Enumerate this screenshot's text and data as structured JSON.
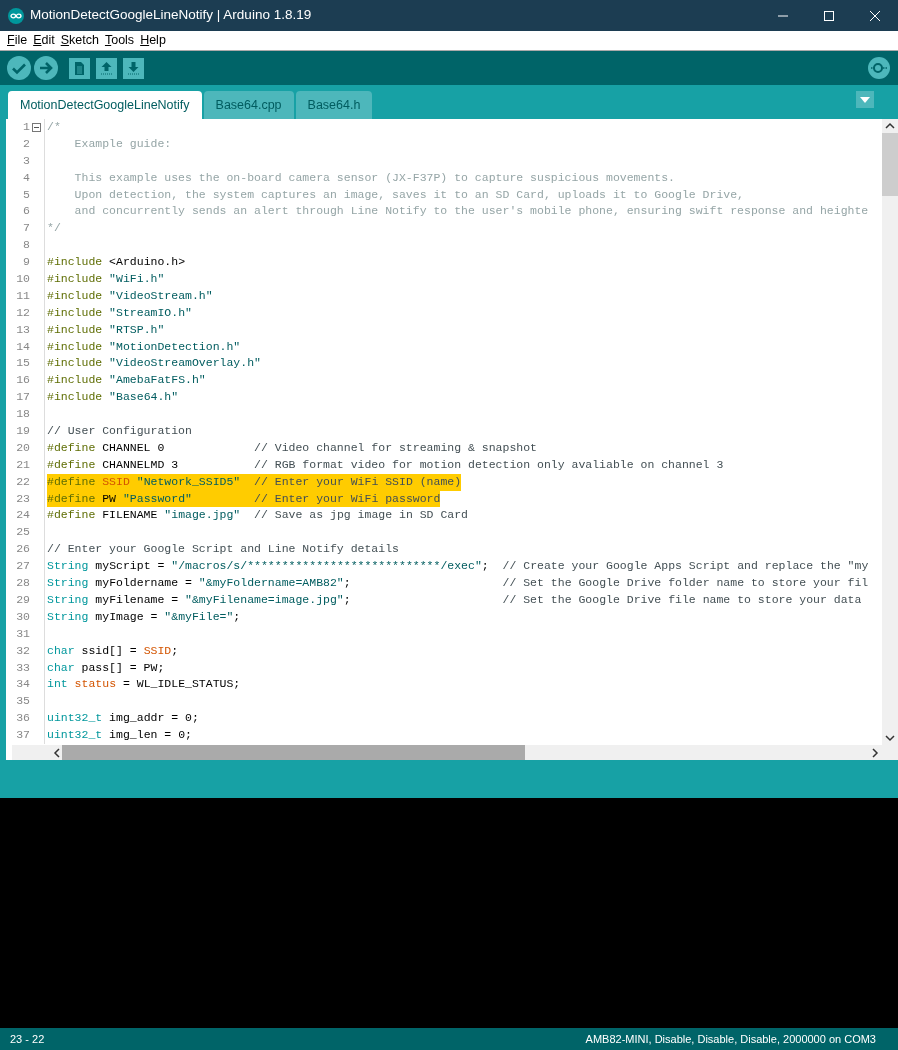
{
  "window": {
    "title": "MotionDetectGoogleLineNotify | Arduino 1.8.19"
  },
  "menu": [
    "File",
    "Edit",
    "Sketch",
    "Tools",
    "Help"
  ],
  "tabs": [
    {
      "label": "MotionDetectGoogleLineNotify",
      "selected": true
    },
    {
      "label": "Base64.cpp",
      "selected": false
    },
    {
      "label": "Base64.h",
      "selected": false
    }
  ],
  "editor": {
    "lines": [
      {
        "number": "1",
        "fold": true,
        "highlighted": false,
        "tokens": [
          {
            "kind": "block_comment",
            "text": "/*"
          }
        ]
      },
      {
        "number": "2",
        "fold": false,
        "highlighted": false,
        "tokens": [
          {
            "kind": "block_comment",
            "text": "    Example guide:"
          }
        ]
      },
      {
        "number": "3",
        "fold": false,
        "highlighted": false
      },
      {
        "number": "4",
        "fold": false,
        "highlighted": false,
        "tokens": [
          {
            "kind": "block_comment",
            "text": "    This example uses the on-board camera sensor (JX-F37P) to capture suspicious movements."
          }
        ]
      },
      {
        "number": "5",
        "fold": false,
        "highlighted": false,
        "tokens": [
          {
            "kind": "block_comment",
            "text": "    Upon detection, the system captures an image, saves it to an SD Card, uploads it to Google Drive,"
          }
        ]
      },
      {
        "number": "6",
        "fold": false,
        "highlighted": false,
        "tokens": [
          {
            "kind": "block_comment",
            "text": "    and concurrently sends an alert through Line Notify to the user's mobile phone, ensuring swift response and heighte"
          }
        ]
      },
      {
        "number": "7",
        "fold": false,
        "highlighted": false,
        "tokens": [
          {
            "kind": "block_comment",
            "text": "*/"
          }
        ]
      },
      {
        "number": "8",
        "fold": false,
        "highlighted": false
      },
      {
        "number": "9",
        "fold": false,
        "highlighted": false,
        "tokens": [
          {
            "kind": "directive",
            "text": "#include"
          },
          {
            "kind": "plain",
            "text": " <Arduino.h>"
          }
        ]
      },
      {
        "number": "10",
        "fold": false,
        "highlighted": false,
        "tokens": [
          {
            "kind": "directive",
            "text": "#include"
          },
          {
            "kind": "string",
            "text": " \"WiFi.h\""
          }
        ]
      },
      {
        "number": "11",
        "fold": false,
        "highlighted": false,
        "tokens": [
          {
            "kind": "directive",
            "text": "#include"
          },
          {
            "kind": "string",
            "text": " \"VideoStream.h\""
          }
        ]
      },
      {
        "number": "12",
        "fold": false,
        "highlighted": false,
        "tokens": [
          {
            "kind": "directive",
            "text": "#include"
          },
          {
            "kind": "string",
            "text": " \"StreamIO.h\""
          }
        ]
      },
      {
        "number": "13",
        "fold": false,
        "highlighted": false,
        "tokens": [
          {
            "kind": "directive",
            "text": "#include"
          },
          {
            "kind": "string",
            "text": " \"RTSP.h\""
          }
        ]
      },
      {
        "number": "14",
        "fold": false,
        "highlighted": false,
        "tokens": [
          {
            "kind": "directive",
            "text": "#include"
          },
          {
            "kind": "string",
            "text": " \"MotionDetection.h\""
          }
        ]
      },
      {
        "number": "15",
        "fold": false,
        "highlighted": false,
        "tokens": [
          {
            "kind": "directive",
            "text": "#include"
          },
          {
            "kind": "string",
            "text": " \"VideoStreamOverlay.h\""
          }
        ]
      },
      {
        "number": "16",
        "fold": false,
        "highlighted": false,
        "tokens": [
          {
            "kind": "directive",
            "text": "#include"
          },
          {
            "kind": "string",
            "text": " \"AmebaFatFS.h\""
          }
        ]
      },
      {
        "number": "17",
        "fold": false,
        "highlighted": false,
        "tokens": [
          {
            "kind": "directive",
            "text": "#include"
          },
          {
            "kind": "string",
            "text": " \"Base64.h\""
          }
        ]
      },
      {
        "number": "18",
        "fold": false,
        "highlighted": false
      },
      {
        "number": "19",
        "fold": false,
        "highlighted": false,
        "tokens": [
          {
            "kind": "comment",
            "text": "// User Configuration"
          }
        ]
      },
      {
        "number": "20",
        "fold": false,
        "highlighted": false,
        "tokens": [
          {
            "kind": "directive",
            "text": "#define"
          },
          {
            "kind": "plain",
            "text": " CHANNEL 0             "
          },
          {
            "kind": "comment",
            "text": "// Video channel for streaming & snapshot"
          }
        ]
      },
      {
        "number": "21",
        "fold": false,
        "highlighted": false,
        "tokens": [
          {
            "kind": "directive",
            "text": "#define"
          },
          {
            "kind": "plain",
            "text": " CHANNELMD 3           "
          },
          {
            "kind": "comment",
            "text": "// RGB format video for motion detection only avaliable on channel 3"
          }
        ]
      },
      {
        "number": "22",
        "fold": false,
        "highlighted": true,
        "tokens": [
          {
            "kind": "directive",
            "text": "#define"
          },
          {
            "kind": "constant",
            "text": " SSID"
          },
          {
            "kind": "string",
            "text": " \"Network_SSID5\"  "
          },
          {
            "kind": "comment",
            "text": "// Enter your WiFi SSID (name)"
          }
        ]
      },
      {
        "number": "23",
        "fold": false,
        "highlighted": true,
        "tokens": [
          {
            "kind": "directive",
            "text": "#define"
          },
          {
            "kind": "plain",
            "text": " PW"
          },
          {
            "kind": "string",
            "text": " \"Password\"         "
          },
          {
            "kind": "comment",
            "text": "// Enter your WiFi password"
          }
        ]
      },
      {
        "number": "24",
        "fold": false,
        "highlighted": false,
        "tokens": [
          {
            "kind": "directive",
            "text": "#define"
          },
          {
            "kind": "plain",
            "text": " FILENAME"
          },
          {
            "kind": "string",
            "text": " \"image.jpg\"  "
          },
          {
            "kind": "comment",
            "text": "// Save as jpg image in SD Card"
          }
        ]
      },
      {
        "number": "25",
        "fold": false,
        "highlighted": false
      },
      {
        "number": "26",
        "fold": false,
        "highlighted": false,
        "tokens": [
          {
            "kind": "comment",
            "text": "// Enter your Google Script and Line Notify details"
          }
        ]
      },
      {
        "number": "27",
        "fold": false,
        "highlighted": false,
        "tokens": [
          {
            "kind": "type",
            "text": "String"
          },
          {
            "kind": "plain",
            "text": " myScript = "
          },
          {
            "kind": "string",
            "text": "\"/macros/s/****************************/exec\""
          },
          {
            "kind": "plain",
            "text": ";  "
          },
          {
            "kind": "comment",
            "text": "// Create your Google Apps Script and replace the \"my"
          }
        ]
      },
      {
        "number": "28",
        "fold": false,
        "highlighted": false,
        "tokens": [
          {
            "kind": "type",
            "text": "String"
          },
          {
            "kind": "plain",
            "text": " myFoldername = "
          },
          {
            "kind": "string",
            "text": "\"&myFoldername=AMB82\""
          },
          {
            "kind": "plain",
            "text": ";                      "
          },
          {
            "kind": "comment",
            "text": "// Set the Google Drive folder name to store your fil"
          }
        ]
      },
      {
        "number": "29",
        "fold": false,
        "highlighted": false,
        "tokens": [
          {
            "kind": "type",
            "text": "String"
          },
          {
            "kind": "plain",
            "text": " myFilename = "
          },
          {
            "kind": "string",
            "text": "\"&myFilename=image.jpg\""
          },
          {
            "kind": "plain",
            "text": ";                      "
          },
          {
            "kind": "comment",
            "text": "// Set the Google Drive file name to store your data"
          }
        ]
      },
      {
        "number": "30",
        "fold": false,
        "highlighted": false,
        "tokens": [
          {
            "kind": "type",
            "text": "String"
          },
          {
            "kind": "plain",
            "text": " myImage = "
          },
          {
            "kind": "string",
            "text": "\"&myFile=\""
          },
          {
            "kind": "plain",
            "text": ";"
          }
        ]
      },
      {
        "number": "31",
        "fold": false,
        "highlighted": false
      },
      {
        "number": "32",
        "fold": false,
        "highlighted": false,
        "tokens": [
          {
            "kind": "type",
            "text": "char"
          },
          {
            "kind": "plain",
            "text": " ssid[] = "
          },
          {
            "kind": "constant",
            "text": "SSID"
          },
          {
            "kind": "plain",
            "text": ";"
          }
        ]
      },
      {
        "number": "33",
        "fold": false,
        "highlighted": false,
        "tokens": [
          {
            "kind": "type",
            "text": "char"
          },
          {
            "kind": "plain",
            "text": " pass[] = PW;"
          }
        ]
      },
      {
        "number": "34",
        "fold": false,
        "highlighted": false,
        "tokens": [
          {
            "kind": "type",
            "text": "int"
          },
          {
            "kind": "constant",
            "text": " status"
          },
          {
            "kind": "plain",
            "text": " = WL_IDLE_STATUS;"
          }
        ]
      },
      {
        "number": "35",
        "fold": false,
        "highlighted": false
      },
      {
        "number": "36",
        "fold": false,
        "highlighted": false,
        "tokens": [
          {
            "kind": "type",
            "text": "uint32_t"
          },
          {
            "kind": "plain",
            "text": " img_addr = 0;"
          }
        ]
      },
      {
        "number": "37",
        "fold": false,
        "highlighted": false,
        "tokens": [
          {
            "kind": "type",
            "text": "uint32_t"
          },
          {
            "kind": "plain",
            "text": " img_len = 0;"
          }
        ]
      }
    ]
  },
  "status_bar": {
    "position": "23 - 22",
    "board": "AMB82-MINI, Disable, Disable, Disable, 2000000 on COM3"
  }
}
